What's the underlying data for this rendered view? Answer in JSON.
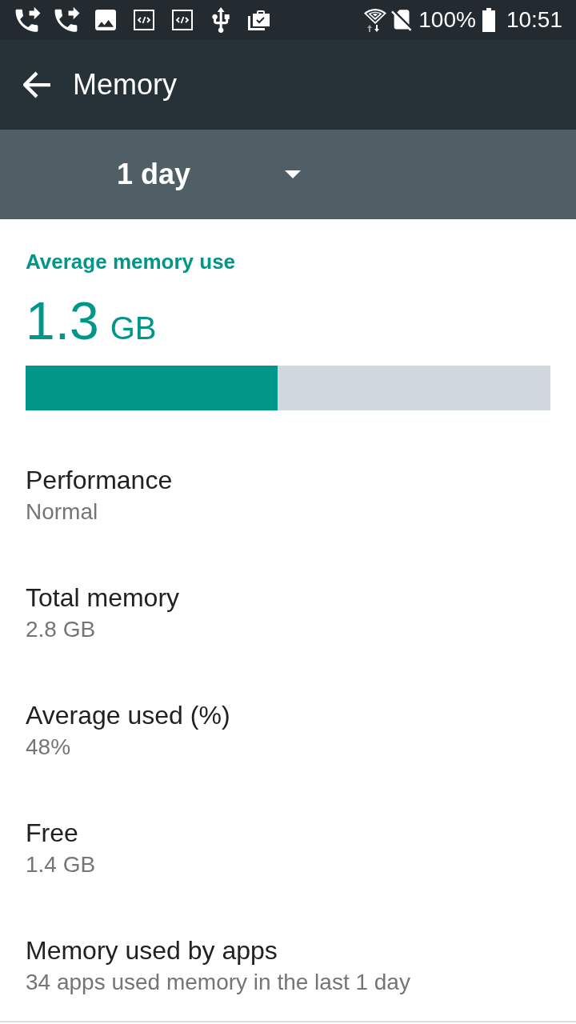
{
  "status_bar": {
    "battery": "100%",
    "time": "10:51"
  },
  "app_bar": {
    "title": "Memory"
  },
  "period_spinner": {
    "value": "1 day"
  },
  "summary": {
    "label": "Average memory use",
    "amount": "1.3",
    "unit": "GB",
    "level": 0.48
  },
  "items": [
    {
      "title": "Performance",
      "summary": "Normal"
    },
    {
      "title": "Total memory",
      "summary": "2.8 GB"
    },
    {
      "title": "Average used (%)",
      "summary": "48%"
    },
    {
      "title": "Free",
      "summary": "1.4 GB"
    },
    {
      "title": "Memory used by apps",
      "summary": "34 apps used memory in the last 1 day"
    }
  ]
}
